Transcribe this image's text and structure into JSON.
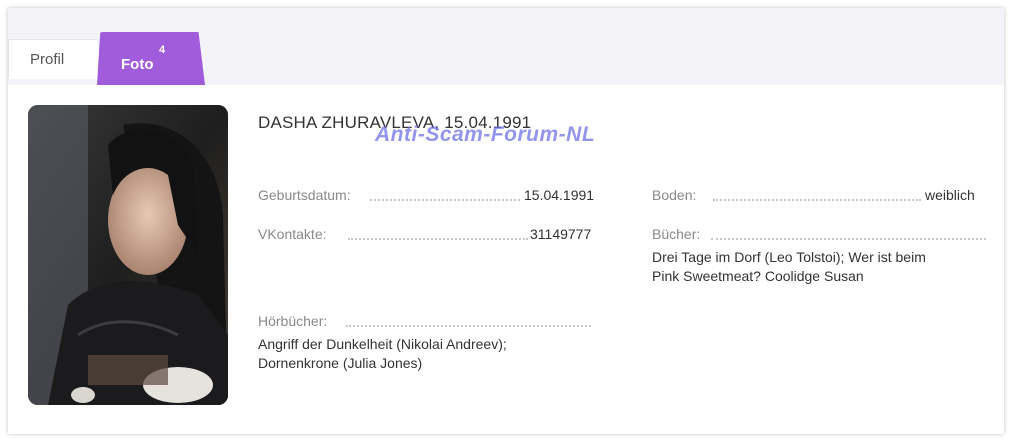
{
  "tabs": {
    "profil_label": "Profil",
    "foto_label": "Foto",
    "foto_count": "4"
  },
  "profile": {
    "title": "DASHA ZHURAVLEVA, 15.04.1991",
    "birthdate_label": "Geburtsdatum:",
    "birthdate_value": "15.04.1991",
    "vk_label": "VKontakte:",
    "vk_value": "31149777",
    "audiobooks_label": "Hörbücher:",
    "audiobooks_value_line1": "Angriff der Dunkelheit (Nikolai Andreev);",
    "audiobooks_value_line2": "Dornenkrone (Julia Jones)",
    "gender_label": "Boden:",
    "gender_value": "weiblich",
    "books_label": "Bücher:",
    "books_value_line1": "Drei Tage im Dorf (Leo Tolstoi); Wer ist beim",
    "books_value_line2": "Pink Sweetmeat? Coolidge Susan"
  },
  "watermark": "Anti-Scam-Forum-NL",
  "colors": {
    "accent": "#a15cdb",
    "tabbar_bg": "#f4f4f8",
    "label": "#8a8a8a",
    "text": "#333333",
    "watermark": "#6f72e6"
  }
}
